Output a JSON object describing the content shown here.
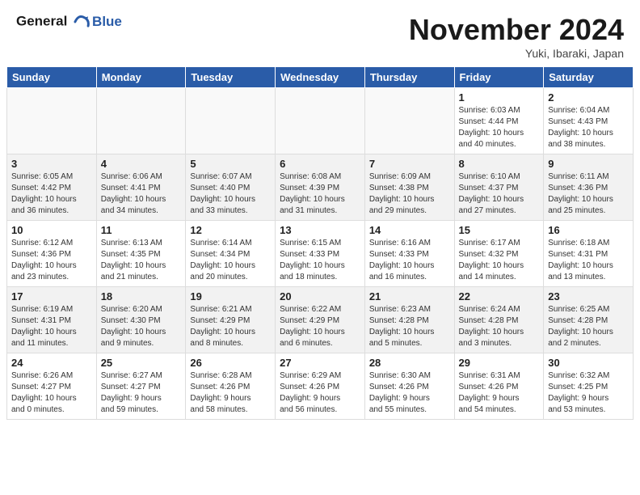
{
  "header": {
    "logo_line1": "General",
    "logo_line2": "Blue",
    "title": "November 2024",
    "location": "Yuki, Ibaraki, Japan"
  },
  "weekdays": [
    "Sunday",
    "Monday",
    "Tuesday",
    "Wednesday",
    "Thursday",
    "Friday",
    "Saturday"
  ],
  "weeks": [
    [
      {
        "day": "",
        "info": ""
      },
      {
        "day": "",
        "info": ""
      },
      {
        "day": "",
        "info": ""
      },
      {
        "day": "",
        "info": ""
      },
      {
        "day": "",
        "info": ""
      },
      {
        "day": "1",
        "info": "Sunrise: 6:03 AM\nSunset: 4:44 PM\nDaylight: 10 hours\nand 40 minutes."
      },
      {
        "day": "2",
        "info": "Sunrise: 6:04 AM\nSunset: 4:43 PM\nDaylight: 10 hours\nand 38 minutes."
      }
    ],
    [
      {
        "day": "3",
        "info": "Sunrise: 6:05 AM\nSunset: 4:42 PM\nDaylight: 10 hours\nand 36 minutes."
      },
      {
        "day": "4",
        "info": "Sunrise: 6:06 AM\nSunset: 4:41 PM\nDaylight: 10 hours\nand 34 minutes."
      },
      {
        "day": "5",
        "info": "Sunrise: 6:07 AM\nSunset: 4:40 PM\nDaylight: 10 hours\nand 33 minutes."
      },
      {
        "day": "6",
        "info": "Sunrise: 6:08 AM\nSunset: 4:39 PM\nDaylight: 10 hours\nand 31 minutes."
      },
      {
        "day": "7",
        "info": "Sunrise: 6:09 AM\nSunset: 4:38 PM\nDaylight: 10 hours\nand 29 minutes."
      },
      {
        "day": "8",
        "info": "Sunrise: 6:10 AM\nSunset: 4:37 PM\nDaylight: 10 hours\nand 27 minutes."
      },
      {
        "day": "9",
        "info": "Sunrise: 6:11 AM\nSunset: 4:36 PM\nDaylight: 10 hours\nand 25 minutes."
      }
    ],
    [
      {
        "day": "10",
        "info": "Sunrise: 6:12 AM\nSunset: 4:36 PM\nDaylight: 10 hours\nand 23 minutes."
      },
      {
        "day": "11",
        "info": "Sunrise: 6:13 AM\nSunset: 4:35 PM\nDaylight: 10 hours\nand 21 minutes."
      },
      {
        "day": "12",
        "info": "Sunrise: 6:14 AM\nSunset: 4:34 PM\nDaylight: 10 hours\nand 20 minutes."
      },
      {
        "day": "13",
        "info": "Sunrise: 6:15 AM\nSunset: 4:33 PM\nDaylight: 10 hours\nand 18 minutes."
      },
      {
        "day": "14",
        "info": "Sunrise: 6:16 AM\nSunset: 4:33 PM\nDaylight: 10 hours\nand 16 minutes."
      },
      {
        "day": "15",
        "info": "Sunrise: 6:17 AM\nSunset: 4:32 PM\nDaylight: 10 hours\nand 14 minutes."
      },
      {
        "day": "16",
        "info": "Sunrise: 6:18 AM\nSunset: 4:31 PM\nDaylight: 10 hours\nand 13 minutes."
      }
    ],
    [
      {
        "day": "17",
        "info": "Sunrise: 6:19 AM\nSunset: 4:31 PM\nDaylight: 10 hours\nand 11 minutes."
      },
      {
        "day": "18",
        "info": "Sunrise: 6:20 AM\nSunset: 4:30 PM\nDaylight: 10 hours\nand 9 minutes."
      },
      {
        "day": "19",
        "info": "Sunrise: 6:21 AM\nSunset: 4:29 PM\nDaylight: 10 hours\nand 8 minutes."
      },
      {
        "day": "20",
        "info": "Sunrise: 6:22 AM\nSunset: 4:29 PM\nDaylight: 10 hours\nand 6 minutes."
      },
      {
        "day": "21",
        "info": "Sunrise: 6:23 AM\nSunset: 4:28 PM\nDaylight: 10 hours\nand 5 minutes."
      },
      {
        "day": "22",
        "info": "Sunrise: 6:24 AM\nSunset: 4:28 PM\nDaylight: 10 hours\nand 3 minutes."
      },
      {
        "day": "23",
        "info": "Sunrise: 6:25 AM\nSunset: 4:28 PM\nDaylight: 10 hours\nand 2 minutes."
      }
    ],
    [
      {
        "day": "24",
        "info": "Sunrise: 6:26 AM\nSunset: 4:27 PM\nDaylight: 10 hours\nand 0 minutes."
      },
      {
        "day": "25",
        "info": "Sunrise: 6:27 AM\nSunset: 4:27 PM\nDaylight: 9 hours\nand 59 minutes."
      },
      {
        "day": "26",
        "info": "Sunrise: 6:28 AM\nSunset: 4:26 PM\nDaylight: 9 hours\nand 58 minutes."
      },
      {
        "day": "27",
        "info": "Sunrise: 6:29 AM\nSunset: 4:26 PM\nDaylight: 9 hours\nand 56 minutes."
      },
      {
        "day": "28",
        "info": "Sunrise: 6:30 AM\nSunset: 4:26 PM\nDaylight: 9 hours\nand 55 minutes."
      },
      {
        "day": "29",
        "info": "Sunrise: 6:31 AM\nSunset: 4:26 PM\nDaylight: 9 hours\nand 54 minutes."
      },
      {
        "day": "30",
        "info": "Sunrise: 6:32 AM\nSunset: 4:25 PM\nDaylight: 9 hours\nand 53 minutes."
      }
    ]
  ]
}
